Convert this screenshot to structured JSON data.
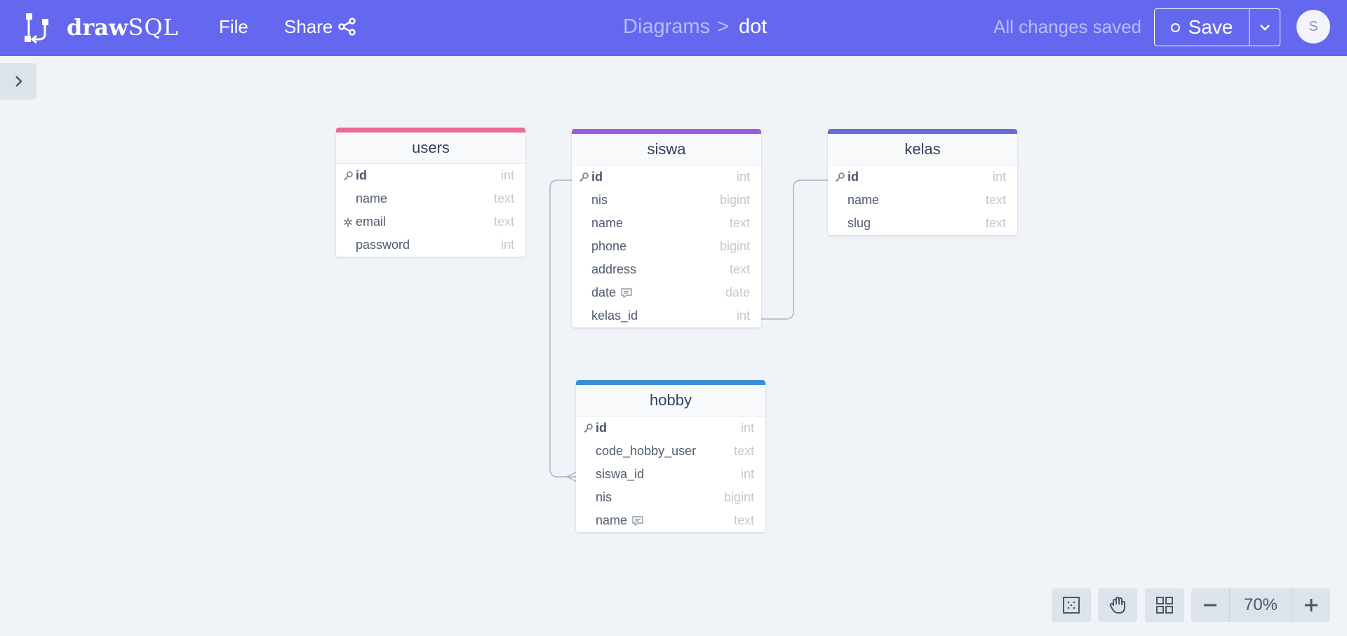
{
  "app": {
    "logo_text_bold": "draw",
    "logo_text_light": "SQL",
    "menu": {
      "file": "File",
      "share": "Share"
    }
  },
  "breadcrumb": {
    "parent": "Diagrams",
    "separator": ">",
    "current": "dot"
  },
  "status": {
    "save_text": "All changes saved"
  },
  "save_button": {
    "label": "Save"
  },
  "user": {
    "avatar_initial": "S"
  },
  "tables": {
    "users": {
      "name": "users",
      "color": "#ec6a95",
      "fields": [
        {
          "name": "id",
          "type": "int",
          "icon": "key-icon"
        },
        {
          "name": "name",
          "type": "text"
        },
        {
          "name": "email",
          "type": "text",
          "icon": "unique-icon"
        },
        {
          "name": "password",
          "type": "int"
        }
      ]
    },
    "siswa": {
      "name": "siswa",
      "color": "#9a5ed8",
      "fields": [
        {
          "name": "id",
          "type": "int",
          "icon": "key-icon"
        },
        {
          "name": "nis",
          "type": "bigint"
        },
        {
          "name": "name",
          "type": "text"
        },
        {
          "name": "phone",
          "type": "bigint"
        },
        {
          "name": "address",
          "type": "text"
        },
        {
          "name": "date",
          "type": "date",
          "comment": true
        },
        {
          "name": "kelas_id",
          "type": "int"
        }
      ]
    },
    "kelas": {
      "name": "kelas",
      "color": "#6470d4",
      "fields": [
        {
          "name": "id",
          "type": "int",
          "icon": "key-icon"
        },
        {
          "name": "name",
          "type": "text"
        },
        {
          "name": "slug",
          "type": "text"
        }
      ]
    },
    "hobby": {
      "name": "hobby",
      "color": "#3a8fd9",
      "fields": [
        {
          "name": "id",
          "type": "int",
          "icon": "key-icon"
        },
        {
          "name": "code_hobby_user",
          "type": "text"
        },
        {
          "name": "siswa_id",
          "type": "int"
        },
        {
          "name": "nis",
          "type": "bigint"
        },
        {
          "name": "name",
          "type": "text",
          "comment": true
        }
      ]
    }
  },
  "relations": [
    {
      "from": "siswa.kelas_id",
      "to": "kelas.id"
    },
    {
      "from": "hobby.siswa_id",
      "to": "siswa.id"
    }
  ],
  "toolbar": {
    "zoom_level": "70%"
  }
}
